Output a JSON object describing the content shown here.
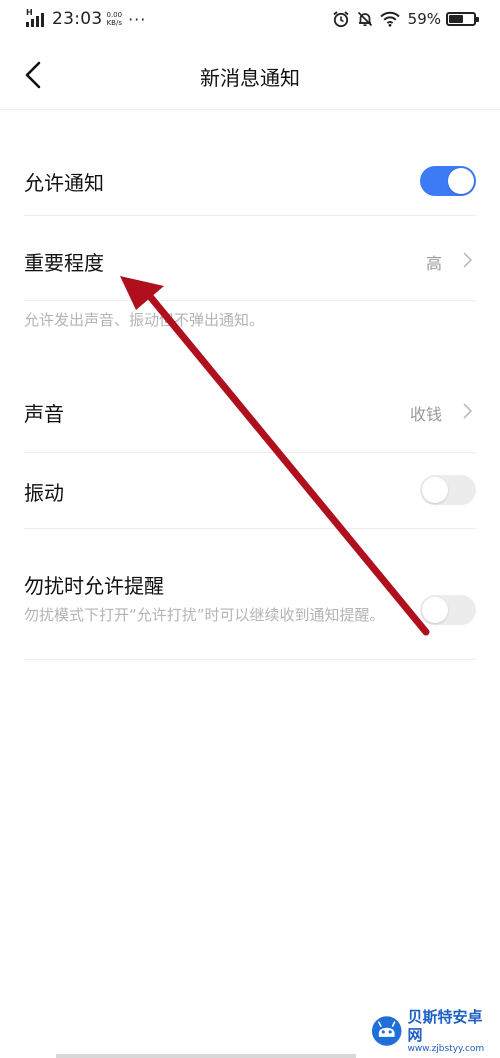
{
  "status_bar": {
    "network_type": "H",
    "time": "23:03",
    "speed_value": "0.00",
    "speed_unit": "KB/s",
    "more": "···",
    "battery_percent": "59%",
    "battery_level": 0.59,
    "icons": [
      "alarm-icon",
      "mute-bell-icon",
      "wifi-icon",
      "battery-icon"
    ]
  },
  "header": {
    "title": "新消息通知",
    "back_icon": "back-chevron-icon"
  },
  "settings": {
    "allow_notifications": {
      "label": "允许通知",
      "enabled": true
    },
    "importance": {
      "label": "重要程度",
      "value": "高"
    },
    "importance_hint": "允许发出声音、振动但不弹出通知。",
    "sound": {
      "label": "声音",
      "value": "收钱"
    },
    "vibration": {
      "label": "振动",
      "enabled": false
    },
    "dnd_allow": {
      "label": "勿扰时允许提醒",
      "description": "勿扰模式下打开“允许打扰”时可以继续收到通知提醒。",
      "enabled": false
    }
  },
  "watermark": {
    "name": "贝斯特安卓网",
    "url": "www.zjbstyy.com"
  },
  "colors": {
    "accent": "#3d7bf5",
    "annotation_arrow": "#b0101e",
    "hint_text": "#b4b4b4"
  }
}
